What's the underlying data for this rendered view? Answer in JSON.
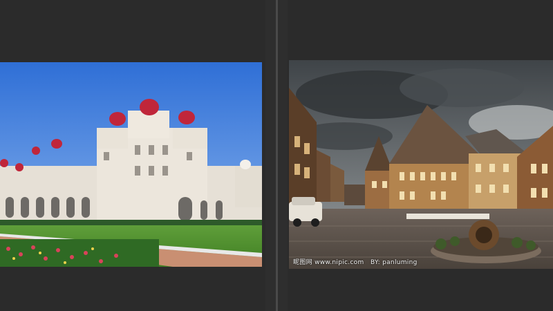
{
  "viewer": {
    "left_image": {
      "subject": "palace-photo"
    },
    "right_image": {
      "subject": "old-town-square-photo",
      "watermark": {
        "site_cn": "昵图网",
        "site_url": "www.nipic.com",
        "author": "BY: panluming"
      }
    }
  },
  "colors": {
    "background": "#2b2b2b",
    "splitter": "#4a4a4a"
  }
}
